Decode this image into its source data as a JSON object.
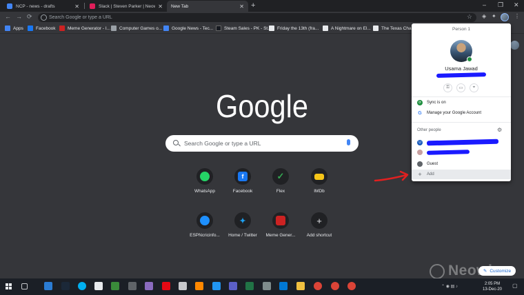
{
  "tabs": [
    {
      "label": "NCP - news - drafts",
      "favicon_color": "#4285f4",
      "active": false
    },
    {
      "label": "Slack | Steven Parker | Neowin",
      "favicon_color": "#e01e5a",
      "active": false
    },
    {
      "label": "New Tab",
      "favicon_color": "",
      "active": true
    }
  ],
  "toolbar": {
    "search_placeholder": "Search Google or type a URL"
  },
  "bookmarks": [
    {
      "label": "Apps",
      "color": "#4285f4"
    },
    {
      "label": "Facebook",
      "color": "#1877f2"
    },
    {
      "label": "Meme Generator - I...",
      "color": "#cc2222"
    },
    {
      "label": "Computer Games o...",
      "color": "#9aa0a6"
    },
    {
      "label": "Google News - Tec...",
      "color": "#4285f4"
    },
    {
      "label": "Steam Sales - PK - St...",
      "color": "#171a21"
    },
    {
      "label": "Friday the 13th (fra...",
      "color": "#e8eaed"
    },
    {
      "label": "A Nightmare on El...",
      "color": "#e8eaed"
    },
    {
      "label": "The Texas Chain",
      "color": "#e8eaed"
    }
  ],
  "ntp": {
    "logo_text": "Google",
    "search_placeholder": "Search Google or type a URL",
    "shortcuts": [
      {
        "label": "WhatsApp",
        "icon": "whatsapp-icon",
        "color": "#25d366",
        "glyph": ""
      },
      {
        "label": "Facebook",
        "icon": "facebook-icon",
        "color": "#1877f2",
        "glyph": "f"
      },
      {
        "label": "Flex",
        "icon": "flex-icon",
        "color": "#34a853",
        "glyph": ""
      },
      {
        "label": "IMDb",
        "icon": "imdb-icon",
        "color": "#f5c518",
        "glyph": ""
      },
      {
        "label": "ESPNcricinfo...",
        "icon": "espncricinfo-icon",
        "color": "#1e90ff",
        "glyph": ""
      },
      {
        "label": "Home / Twitter",
        "icon": "twitter-icon",
        "color": "#1da1f2",
        "glyph": ""
      },
      {
        "label": "Meme Gener...",
        "icon": "meme-generator-icon",
        "color": "#cc2222",
        "glyph": ""
      },
      {
        "label": "Add shortcut",
        "icon": "plus-icon",
        "color": "#202124",
        "glyph": "+"
      }
    ],
    "customize_label": "Customize",
    "watermark": "Neowin"
  },
  "menu": {
    "title": "Person 1",
    "name": "Usama Jawad",
    "sync_label": "Sync is on",
    "manage_label": "Manage your Google Account",
    "other_people_label": "Other people",
    "guest_label": "Guest",
    "add_label": "Add"
  },
  "taskbar": {
    "time": "2:05 PM",
    "date": "13-Dec-20"
  },
  "colors": {
    "accent_red_arrow": "#e02020",
    "redaction": "#1a1aff"
  }
}
